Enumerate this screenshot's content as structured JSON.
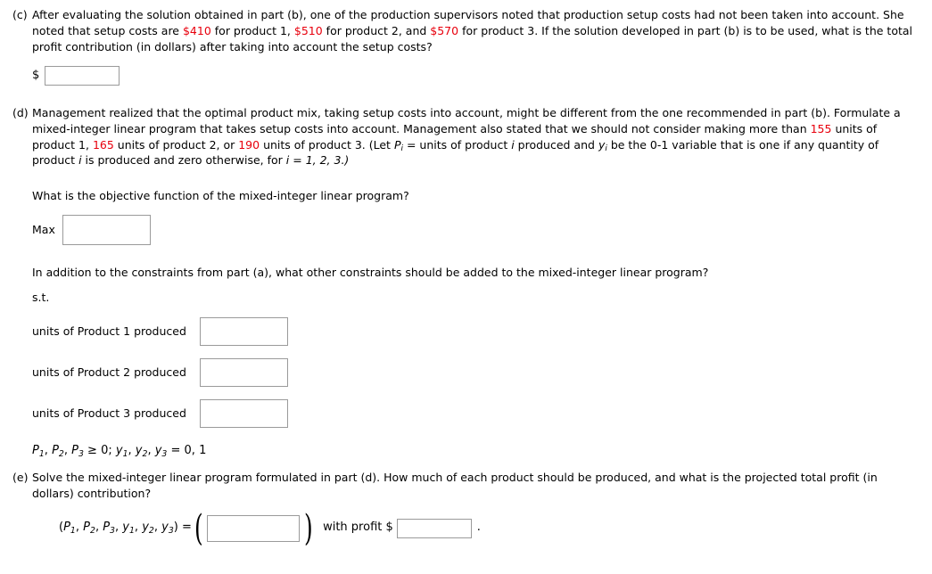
{
  "parts": {
    "c": {
      "label": "(c)",
      "text_before_1": "After evaluating the solution obtained in part (b), one of the production supervisors noted that production setup costs had not been taken into account. She noted that setup costs are ",
      "cost1": "$410",
      "mid_1": " for product 1, ",
      "cost2": "$510",
      "mid_2": " for product 2, and ",
      "cost3": "$570",
      "text_after": " for product 3. If the solution developed in part (b) is to be used, what is the total profit contribution (in dollars) after taking into account the setup costs?",
      "dollar_sign": "$",
      "answer_value": "",
      "answer_placeholder": ""
    },
    "d": {
      "label": "(d)",
      "intro_1": "Management realized that the optimal product mix, taking setup costs into account, might be different from the one recommended in part (b). Formulate a mixed-integer linear program that takes setup costs into account. Management also stated that we should not consider making more than ",
      "limit1": "155",
      "mid_1": " units of product 1, ",
      "limit2": "165",
      "mid_2": " units of product 2, or ",
      "limit3": "190",
      "mid_3": " units of product 3. (Let ",
      "var_P": "P",
      "var_P_sub": "i",
      "mid_4": " = units of product ",
      "var_i": "i",
      "mid_5": " produced and ",
      "var_y": "y",
      "var_y_sub": "i",
      "mid_6": " be the 0-1 variable that is one if any quantity of product ",
      "var_i2": "i",
      "mid_7": " is produced and zero otherwise, for ",
      "i_values": "i = 1, 2, 3.)",
      "objective_question": "What is the objective function of the mixed-integer linear program?",
      "max_label": "Max",
      "max_value": "",
      "constraints_question": "In addition to the constraints from part (a), what other constraints should be added to the mixed-integer linear program?",
      "st_label": "s.t.",
      "constraints": [
        {
          "label": "units of Product 1 produced",
          "value": ""
        },
        {
          "label": "units of Product 2 produced",
          "value": ""
        },
        {
          "label": "units of Product 3 produced",
          "value": ""
        }
      ],
      "nonneg_line": "P1, P2, P3 ≥ 0; y1, y2, y3 = 0, 1"
    },
    "e": {
      "label": "(e)",
      "text": "Solve the mixed-integer linear program formulated in part (d). How much of each product should be produced, and what is the projected total profit (in dollars) contribution?",
      "tuple_text": "(P1, P2, P3, y1, y2, y3) =",
      "answer_value": "",
      "with_profit_label": "with profit $",
      "profit_value": "",
      "period": "."
    }
  },
  "colors": {
    "highlight": "#e8000d",
    "box_border": "#9a9a9a",
    "text": "#000000"
  }
}
